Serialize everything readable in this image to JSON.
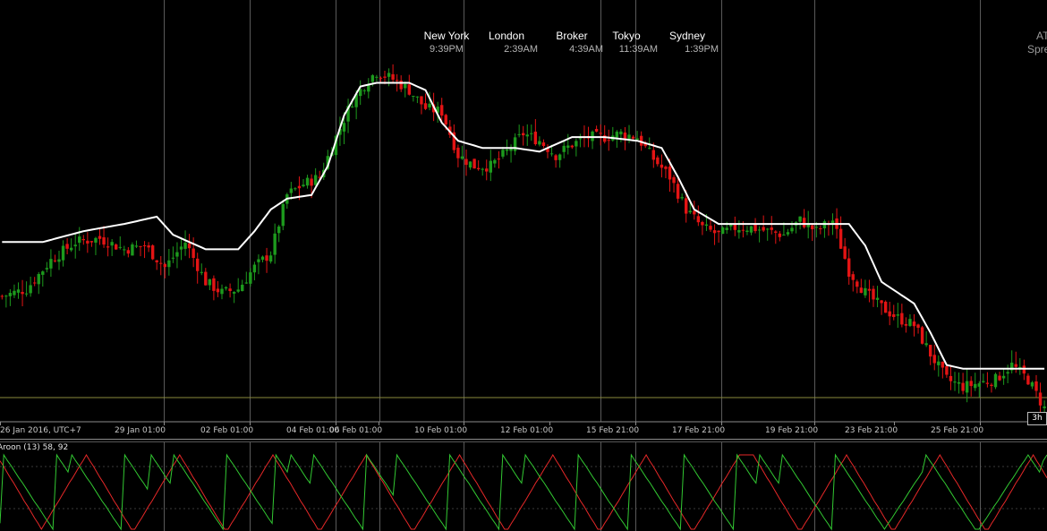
{
  "world_clocks": [
    {
      "city": "New York",
      "time": "9:39PM"
    },
    {
      "city": "London",
      "time": "2:39AM"
    },
    {
      "city": "Broker",
      "time": "4:39AM"
    },
    {
      "city": "Tokyo",
      "time": "11:39AM"
    },
    {
      "city": "Sydney",
      "time": "1:39PM"
    }
  ],
  "right_edge": {
    "top": "AT",
    "bottom": "Spre"
  },
  "timeframe_badge": "3h",
  "colors": {
    "background": "#000000",
    "bull_candle": "#1d9a1d",
    "bear_candle": "#e31414",
    "moving_average": "#ffffff",
    "price_line": "#8a8a3c",
    "grid": "#5a5a5a",
    "aroon_up": "#32c832",
    "aroon_down": "#e62828"
  },
  "chart_data": [
    {
      "type": "candlestick",
      "x_axis_labels": [
        "26 Jan 2016, UTC+7",
        "29 Jan 01:00",
        "02 Feb 01:00",
        "04 Feb 01:00",
        "06 Feb 01:00",
        "10 Feb 01:00",
        "12 Feb 01:00",
        "15 Feb 21:00",
        "17 Feb 21:00",
        "19 Feb 21:00",
        "23 Feb 21:00",
        "25 Feb 21:00"
      ],
      "grid": "vertical-only",
      "overlay": "smoothed moving average (white line)",
      "ylim": [
        0,
        100
      ],
      "close_path": [
        [
          0,
          28
        ],
        [
          6,
          30
        ],
        [
          12,
          38
        ],
        [
          18,
          43
        ],
        [
          24,
          44
        ],
        [
          30,
          41
        ],
        [
          35,
          42
        ],
        [
          40,
          36
        ],
        [
          45,
          43
        ],
        [
          50,
          32
        ],
        [
          54,
          29
        ],
        [
          58,
          30
        ],
        [
          62,
          36
        ],
        [
          66,
          40
        ],
        [
          70,
          56
        ],
        [
          74,
          59
        ],
        [
          78,
          61
        ],
        [
          82,
          72
        ],
        [
          86,
          82
        ],
        [
          90,
          88
        ],
        [
          92,
          90
        ],
        [
          96,
          88
        ],
        [
          100,
          85
        ],
        [
          104,
          80
        ],
        [
          108,
          79
        ],
        [
          112,
          67
        ],
        [
          116,
          64
        ],
        [
          120,
          64
        ],
        [
          124,
          68
        ],
        [
          128,
          73
        ],
        [
          132,
          71
        ],
        [
          136,
          67
        ],
        [
          140,
          70
        ],
        [
          144,
          72
        ],
        [
          148,
          72
        ],
        [
          152,
          73
        ],
        [
          156,
          72
        ],
        [
          160,
          66
        ],
        [
          164,
          61
        ],
        [
          168,
          52
        ],
        [
          172,
          47
        ],
        [
          176,
          45
        ],
        [
          180,
          47
        ],
        [
          184,
          47
        ],
        [
          188,
          46
        ],
        [
          192,
          45
        ],
        [
          196,
          49
        ],
        [
          200,
          46
        ],
        [
          204,
          49
        ],
        [
          208,
          35
        ],
        [
          212,
          29
        ],
        [
          216,
          25
        ],
        [
          220,
          22
        ],
        [
          224,
          20
        ],
        [
          228,
          12
        ],
        [
          232,
          5
        ],
        [
          236,
          3
        ],
        [
          240,
          4
        ],
        [
          244,
          5
        ],
        [
          248,
          9
        ],
        [
          252,
          5
        ],
        [
          256,
          -3
        ]
      ],
      "ma_path": [
        [
          0,
          43
        ],
        [
          10,
          43
        ],
        [
          20,
          46
        ],
        [
          30,
          48
        ],
        [
          38,
          50
        ],
        [
          42,
          45
        ],
        [
          46,
          43
        ],
        [
          50,
          41
        ],
        [
          58,
          41
        ],
        [
          62,
          46
        ],
        [
          66,
          52
        ],
        [
          70,
          55
        ],
        [
          76,
          56
        ],
        [
          80,
          64
        ],
        [
          84,
          78
        ],
        [
          88,
          86
        ],
        [
          92,
          87
        ],
        [
          100,
          87
        ],
        [
          104,
          85
        ],
        [
          108,
          76
        ],
        [
          112,
          71
        ],
        [
          118,
          69
        ],
        [
          126,
          69
        ],
        [
          132,
          68
        ],
        [
          140,
          72
        ],
        [
          148,
          72
        ],
        [
          156,
          71
        ],
        [
          162,
          69
        ],
        [
          166,
          61
        ],
        [
          170,
          52
        ],
        [
          176,
          48
        ],
        [
          184,
          48
        ],
        [
          194,
          48
        ],
        [
          202,
          48
        ],
        [
          208,
          48
        ],
        [
          212,
          42
        ],
        [
          216,
          32
        ],
        [
          220,
          29
        ],
        [
          224,
          26
        ],
        [
          228,
          18
        ],
        [
          232,
          9
        ],
        [
          236,
          8
        ],
        [
          252,
          8
        ],
        [
          256,
          8
        ]
      ],
      "price_line_level": 0
    },
    {
      "type": "line",
      "title": "Aroon (13) 58, 92",
      "ylim": [
        0,
        100
      ],
      "series": [
        {
          "color": "#32c832",
          "values": [
            8,
            100,
            92,
            85,
            77,
            69,
            62,
            54,
            46,
            38,
            31,
            23,
            15,
            8,
            0,
            100,
            92,
            85,
            77,
            100,
            92,
            85,
            77,
            69,
            62,
            54,
            46,
            38,
            31,
            23,
            15,
            8,
            0,
            100,
            92,
            85,
            77,
            69,
            62,
            54,
            100,
            92,
            85,
            77,
            69,
            62,
            100,
            92,
            85,
            77,
            69,
            62,
            54,
            46,
            38,
            31,
            23,
            15,
            8,
            0,
            100,
            92,
            85,
            77,
            69,
            62,
            54,
            46,
            38,
            31,
            23,
            15,
            8,
            100,
            92,
            85,
            77,
            100,
            92,
            85,
            77,
            69,
            62,
            100,
            92,
            85,
            77,
            69,
            62,
            54,
            46,
            38,
            31,
            23,
            15,
            8,
            0,
            100,
            92,
            85,
            77,
            69,
            62,
            54,
            46,
            100,
            92,
            85,
            77,
            69,
            62,
            54,
            46,
            38,
            31,
            23,
            15,
            8,
            0,
            100,
            92,
            85,
            77,
            69,
            62,
            54,
            46,
            38,
            31,
            23,
            15,
            8,
            0,
            100,
            92,
            85,
            77,
            69,
            62,
            100,
            92,
            85,
            77,
            69,
            62,
            54,
            46,
            38,
            31,
            23,
            15,
            8,
            0,
            100,
            92,
            85,
            77,
            69,
            62,
            54,
            46,
            38,
            31,
            23,
            15,
            8,
            0,
            100,
            92,
            85,
            77,
            69,
            62,
            54,
            46,
            38,
            31,
            23,
            15,
            8,
            0,
            100,
            92,
            85,
            77,
            69,
            62,
            54,
            46,
            38,
            31,
            23,
            15,
            8,
            0,
            100,
            92,
            85,
            77,
            69,
            62,
            100,
            92,
            85,
            77,
            69,
            62,
            100,
            92,
            85,
            77,
            69,
            62,
            54,
            46,
            38,
            31,
            23,
            15,
            8,
            0,
            100,
            92,
            85,
            77,
            69,
            62,
            54,
            46,
            38,
            31,
            23,
            15,
            8,
            0,
            8,
            15,
            23,
            31,
            38,
            46,
            54,
            62,
            69,
            77,
            100,
            92,
            85,
            77,
            69,
            62,
            54,
            46,
            38,
            31,
            23,
            15,
            8,
            0,
            0,
            8,
            15,
            23,
            31,
            38,
            46,
            54,
            62,
            69,
            77,
            85,
            92,
            100,
            92,
            85,
            77,
            92,
            100
          ]
        },
        {
          "color": "#e62828",
          "values": [
            92,
            85,
            77,
            69,
            62,
            54,
            46,
            38,
            31,
            23,
            15,
            8,
            0,
            8,
            15,
            23,
            31,
            38,
            46,
            54,
            62,
            69,
            77,
            85,
            92,
            100,
            92,
            85,
            77,
            69,
            62,
            54,
            46,
            38,
            31,
            23,
            15,
            8,
            0,
            0,
            8,
            15,
            23,
            31,
            38,
            46,
            54,
            62,
            69,
            77,
            85,
            92,
            100,
            92,
            85,
            77,
            69,
            62,
            54,
            46,
            38,
            31,
            23,
            15,
            8,
            0,
            0,
            8,
            15,
            23,
            31,
            38,
            46,
            54,
            62,
            69,
            77,
            85,
            92,
            100,
            92,
            85,
            77,
            69,
            62,
            54,
            46,
            38,
            31,
            23,
            15,
            8,
            0,
            0,
            8,
            15,
            23,
            31,
            38,
            46,
            54,
            62,
            69,
            77,
            85,
            92,
            100,
            92,
            85,
            77,
            69,
            62,
            54,
            46,
            38,
            31,
            23,
            15,
            8,
            0,
            0,
            8,
            15,
            23,
            31,
            38,
            46,
            54,
            62,
            69,
            77,
            85,
            92,
            100,
            92,
            85,
            77,
            69,
            62,
            54,
            46,
            38,
            31,
            23,
            15,
            8,
            0,
            0,
            8,
            15,
            23,
            31,
            38,
            46,
            54,
            62,
            69,
            77,
            85,
            92,
            100,
            92,
            85,
            77,
            69,
            62,
            54,
            46,
            38,
            31,
            23,
            15,
            8,
            0,
            0,
            8,
            15,
            23,
            31,
            38,
            46,
            54,
            62,
            69,
            77,
            85,
            92,
            100,
            92,
            85,
            77,
            69,
            62,
            54,
            46,
            38,
            31,
            23,
            15,
            8,
            0,
            0,
            8,
            15,
            23,
            31,
            38,
            46,
            54,
            62,
            69,
            77,
            85,
            92,
            100,
            100,
            100,
            100,
            100,
            92,
            85,
            77,
            69,
            62,
            54,
            46,
            38,
            31,
            23,
            15,
            8,
            0,
            0,
            8,
            15,
            23,
            31,
            38,
            46,
            54,
            62,
            69,
            77,
            85,
            92,
            100,
            92,
            85,
            77,
            69,
            62,
            54,
            46,
            38,
            31,
            23,
            15,
            8,
            0,
            0,
            8,
            15,
            23,
            31,
            38,
            46,
            54,
            62,
            69,
            77,
            85,
            92,
            100,
            92,
            85,
            77,
            69,
            62,
            54,
            46,
            38,
            31,
            23,
            15,
            8,
            0,
            0,
            8,
            15,
            23,
            31,
            38,
            46,
            54,
            62,
            69,
            77,
            85,
            92,
            100,
            92,
            85,
            77,
            69
          ]
        }
      ]
    }
  ]
}
